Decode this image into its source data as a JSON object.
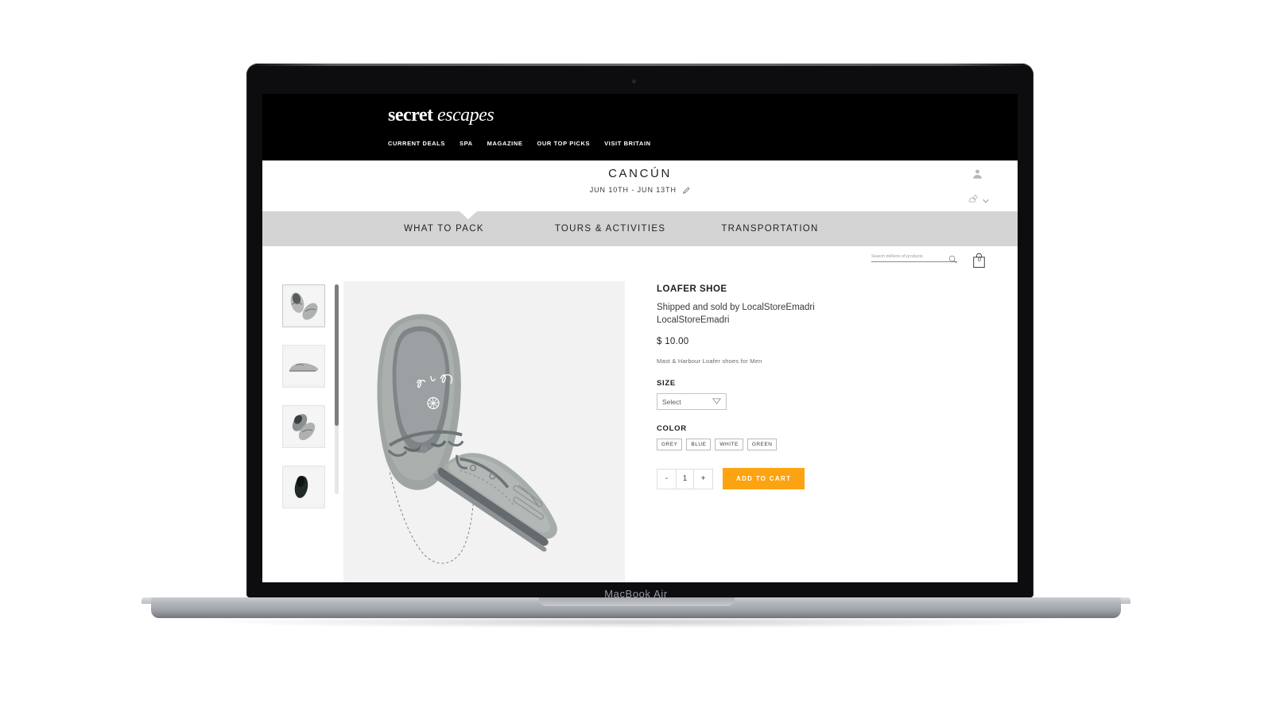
{
  "device": {
    "model_label": "MacBook Air"
  },
  "brandbar": {
    "logo_primary": "secret ",
    "logo_secondary": "escapes",
    "nav": [
      {
        "label": "CURRENT DEALS"
      },
      {
        "label": "SPA"
      },
      {
        "label": "MAGAZINE"
      },
      {
        "label": "OUR TOP PICKS"
      },
      {
        "label": "VISIT BRITAIN"
      }
    ]
  },
  "trip": {
    "destination": "CANCÚN",
    "dates": "JUN 10TH - JUN 13TH",
    "edit_icon": "pencil-icon",
    "account_icon": "user-avatar-icon",
    "weather_icon": "sun-cloud-icon",
    "weather_chevron": "chevron-down-icon"
  },
  "tabs": [
    {
      "label": "WHAT TO PACK",
      "active": true
    },
    {
      "label": "TOURS & ACTIVITIES",
      "active": false
    },
    {
      "label": "TRANSPORTATION",
      "active": false
    }
  ],
  "search": {
    "placeholder": "Search millions of products",
    "value": "",
    "icon": "search-icon"
  },
  "cart": {
    "icon": "shopping-bag-icon",
    "count": "0"
  },
  "gallery": {
    "thumbnails": [
      {
        "alt": "loafer-pair-top-view",
        "selected": true
      },
      {
        "alt": "loafer-side-profile",
        "selected": false
      },
      {
        "alt": "loafer-pair-angled",
        "selected": false
      },
      {
        "alt": "loafer-dark-detail",
        "selected": false
      }
    ],
    "hero_alt": "grey-suede-loafer-pair"
  },
  "product": {
    "title": "LOAFER SHOE",
    "seller": "Shipped and sold by LocalStoreEmadri LocalStoreEmadri",
    "price": "$ 10.00",
    "description": "Mast & Harbour Loafer shoes for Men",
    "size_label": "SIZE",
    "size_selected": "Select",
    "size_options": [
      "Select"
    ],
    "color_label": "COLOR",
    "colors": [
      {
        "label": "GREY"
      },
      {
        "label": "BLUE"
      },
      {
        "label": "WHITE"
      },
      {
        "label": "GREEN"
      }
    ],
    "quantity": {
      "decrement": "-",
      "value": "1",
      "increment": "+"
    },
    "add_to_cart_label": "ADD TO CART"
  },
  "colors": {
    "accent_orange": "#FBA311",
    "tab_strip_grey": "#D4D4D4",
    "brand_black": "#000000",
    "hero_bg": "#F2F2F2"
  }
}
